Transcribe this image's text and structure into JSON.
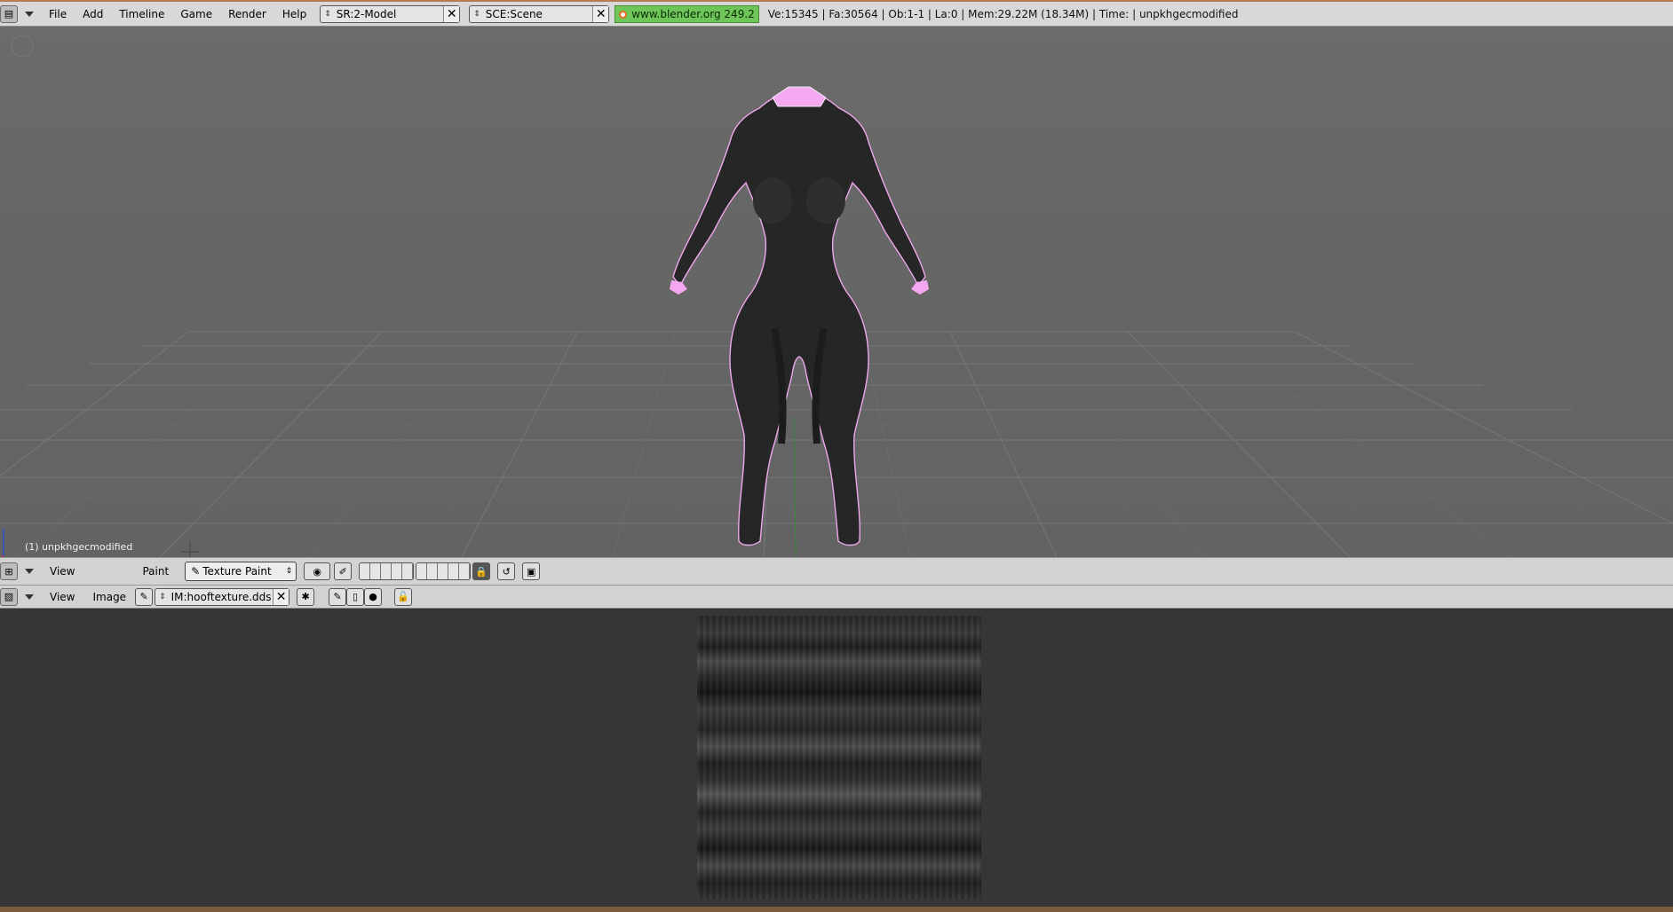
{
  "topbar": {
    "menus": [
      "File",
      "Add",
      "Timeline",
      "Game",
      "Render",
      "Help"
    ],
    "screen_field": "SR:2-Model",
    "scene_field": "SCE:Scene",
    "website": "www.blender.org 249.2",
    "stats": "Ve:15345 | Fa:30564 | Ob:1-1 | La:0  | Mem:29.22M (18.34M)  | Time: | unpkhgecmodified"
  },
  "viewport": {
    "object_label": "(1) unpkhgecmodified"
  },
  "header_3d": {
    "view_label": "View",
    "paint_label": "Paint",
    "mode": "Texture Paint"
  },
  "header_image": {
    "view_label": "View",
    "image_label": "Image",
    "image_name": "IM:hooftexture.dds"
  },
  "colors": {
    "viewport_bg": "#666666",
    "grid_line": "#7a7a7a",
    "mesh": "#222222",
    "selection": "#f4a8f0",
    "website_bg": "#6ec65a"
  }
}
